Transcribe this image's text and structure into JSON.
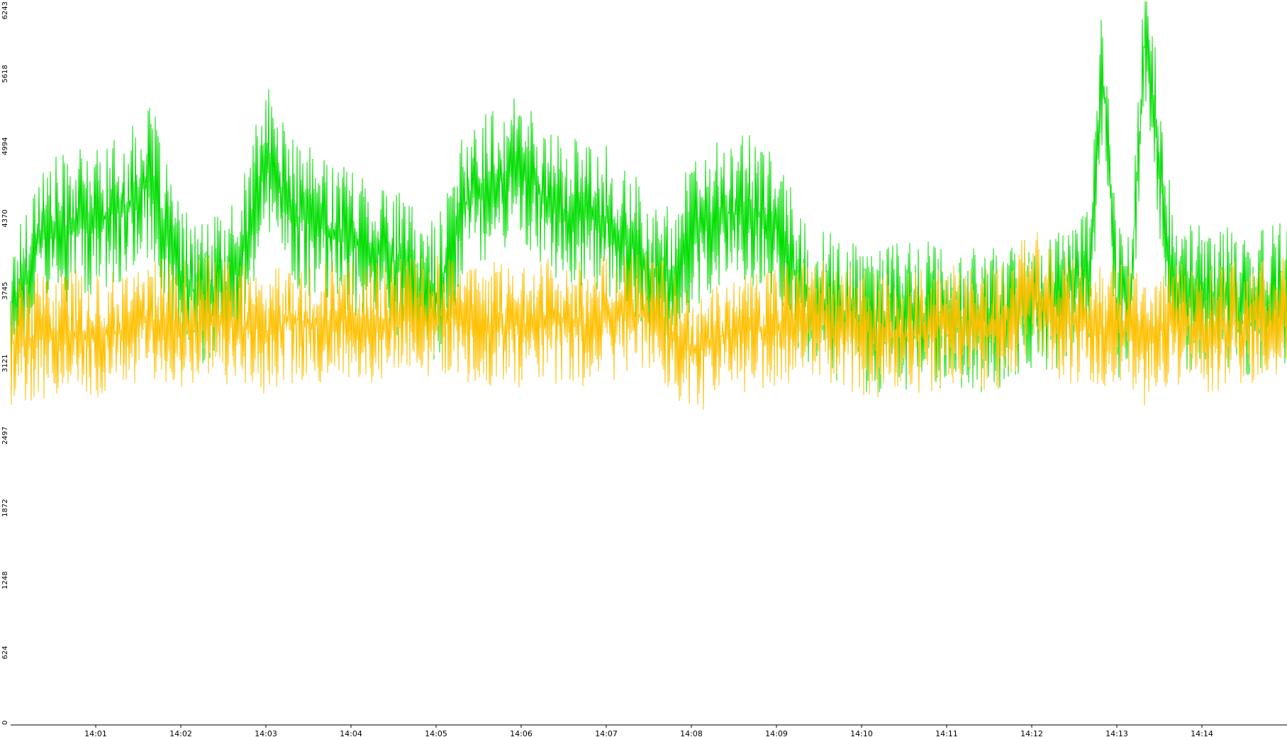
{
  "chart_data": {
    "type": "line",
    "title": "",
    "xlabel": "",
    "ylabel": "",
    "ylim": [
      0,
      6243
    ],
    "yticks": [
      "0",
      "624",
      "1248",
      "1872",
      "2497",
      "3121",
      "3745",
      "4370",
      "4994",
      "5618",
      "6243"
    ],
    "xrange_minutes": [
      "14:00",
      "14:15"
    ],
    "xticks": [
      "14:01",
      "14:02",
      "14:03",
      "14:04",
      "14:05",
      "14:06",
      "14:07",
      "14:08",
      "14:09",
      "14:10",
      "14:11",
      "14:12",
      "14:13",
      "14:14"
    ],
    "grid": false,
    "legend": "none",
    "series": [
      {
        "color": "#00dd00",
        "x": [
          "14:00:00",
          "14:00:20",
          "14:00:40",
          "14:01:00",
          "14:01:20",
          "14:01:40",
          "14:02:00",
          "14:02:20",
          "14:02:40",
          "14:03:00",
          "14:03:20",
          "14:03:40",
          "14:04:00",
          "14:04:20",
          "14:04:40",
          "14:05:00",
          "14:05:20",
          "14:05:40",
          "14:06:00",
          "14:06:20",
          "14:06:40",
          "14:07:00",
          "14:07:20",
          "14:07:40",
          "14:08:00",
          "14:08:20",
          "14:08:40",
          "14:09:00",
          "14:09:20",
          "14:09:40",
          "14:10:00",
          "14:10:20",
          "14:10:40",
          "14:11:00",
          "14:11:20",
          "14:11:40",
          "14:12:00",
          "14:12:20",
          "14:12:40",
          "14:12:50",
          "14:13:00",
          "14:13:10",
          "14:13:20",
          "14:13:40",
          "14:14:00",
          "14:14:20",
          "14:14:40",
          "14:15:00"
        ],
        "values": [
          3500,
          4200,
          4300,
          4350,
          4450,
          4700,
          3800,
          3700,
          3900,
          4900,
          4400,
          4300,
          4200,
          4100,
          3900,
          3700,
          4500,
          4700,
          4800,
          4500,
          4400,
          4350,
          4100,
          3800,
          4200,
          4400,
          4450,
          4300,
          3700,
          3600,
          3500,
          3500,
          3550,
          3500,
          3500,
          3550,
          3600,
          3700,
          3900,
          5700,
          3600,
          3800,
          6000,
          3750,
          3650,
          3700,
          3650,
          3700
        ]
      },
      {
        "color": "#ffc000",
        "x": [
          "14:00:00",
          "14:00:20",
          "14:00:40",
          "14:01:00",
          "14:01:20",
          "14:01:40",
          "14:02:00",
          "14:02:20",
          "14:02:40",
          "14:03:00",
          "14:03:20",
          "14:03:40",
          "14:04:00",
          "14:04:20",
          "14:04:40",
          "14:05:00",
          "14:05:20",
          "14:05:40",
          "14:06:00",
          "14:06:20",
          "14:06:40",
          "14:07:00",
          "14:07:20",
          "14:07:40",
          "14:08:00",
          "14:08:20",
          "14:08:40",
          "14:09:00",
          "14:09:20",
          "14:09:40",
          "14:10:00",
          "14:10:20",
          "14:10:40",
          "14:11:00",
          "14:11:20",
          "14:11:40",
          "14:12:00",
          "14:12:20",
          "14:12:40",
          "14:12:50",
          "14:13:00",
          "14:13:10",
          "14:13:20",
          "14:13:40",
          "14:14:00",
          "14:14:20",
          "14:14:40",
          "14:15:00"
        ],
        "values": [
          3300,
          3350,
          3400,
          3350,
          3400,
          3500,
          3450,
          3500,
          3450,
          3400,
          3500,
          3450,
          3500,
          3450,
          3500,
          3550,
          3500,
          3450,
          3450,
          3500,
          3450,
          3500,
          3550,
          3500,
          3200,
          3350,
          3400,
          3450,
          3500,
          3450,
          3400,
          3350,
          3400,
          3450,
          3400,
          3450,
          3800,
          3500,
          3450,
          3400,
          3500,
          3450,
          3300,
          3500,
          3400,
          3450,
          3500,
          3500
        ]
      }
    ]
  }
}
